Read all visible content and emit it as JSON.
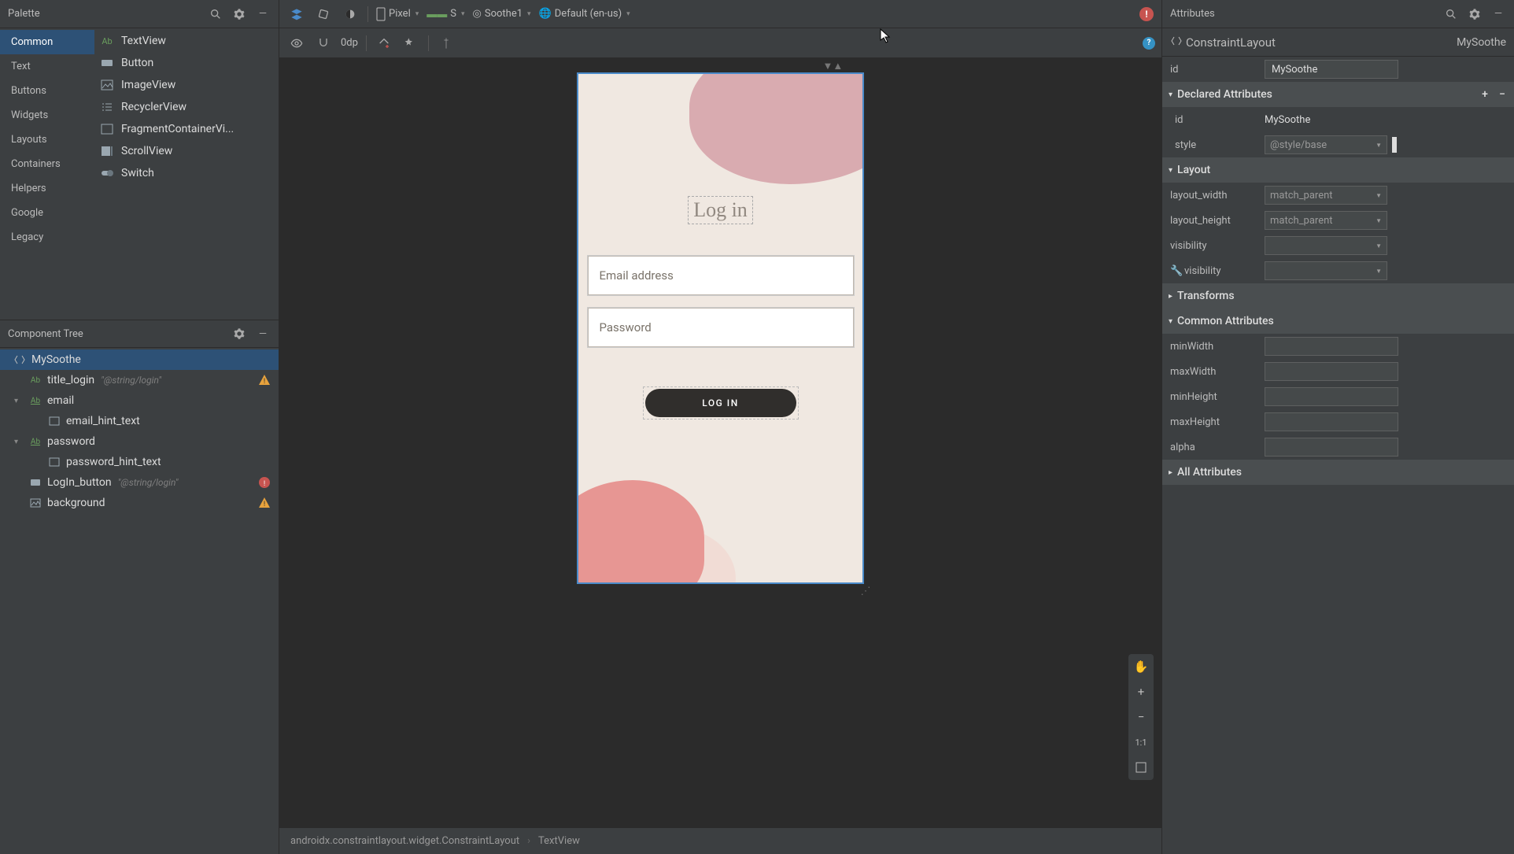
{
  "palette": {
    "title": "Palette",
    "categories": [
      "Common",
      "Text",
      "Buttons",
      "Widgets",
      "Layouts",
      "Containers",
      "Helpers",
      "Google",
      "Legacy"
    ],
    "selected_category": "Common",
    "items": [
      {
        "icon": "Ab",
        "label": "TextView"
      },
      {
        "icon": "rect",
        "label": "Button"
      },
      {
        "icon": "image",
        "label": "ImageView"
      },
      {
        "icon": "list",
        "label": "RecyclerView"
      },
      {
        "icon": "frame",
        "label": "FragmentContainerVi..."
      },
      {
        "icon": "scroll",
        "label": "ScrollView"
      },
      {
        "icon": "switch",
        "label": "Switch"
      }
    ]
  },
  "component_tree": {
    "title": "Component Tree",
    "nodes": [
      {
        "level": 0,
        "icon": "constraint",
        "label": "MySoothe",
        "selected": true
      },
      {
        "level": 1,
        "icon": "Ab",
        "label": "title_login",
        "ann": "\"@string/login\"",
        "warn": "warning"
      },
      {
        "level": 1,
        "icon": "Ab",
        "label": "email",
        "chevron": true
      },
      {
        "level": 2,
        "icon": "frame",
        "label": "email_hint_text"
      },
      {
        "level": 1,
        "icon": "Ab",
        "label": "password",
        "chevron": true
      },
      {
        "level": 2,
        "icon": "frame",
        "label": "password_hint_text"
      },
      {
        "level": 1,
        "icon": "rect",
        "label": "LogIn_button",
        "ann": "\"@string/login\"",
        "warn": "error"
      },
      {
        "level": 1,
        "icon": "image",
        "label": "background",
        "warn": "warning"
      }
    ]
  },
  "toolbar": {
    "device": "Pixel",
    "api": "S",
    "theme": "Soothe1",
    "locale": "Default (en-us)",
    "dp": "0dp"
  },
  "design": {
    "login_title": "Log in",
    "email_hint": "Email address",
    "password_hint": "Password",
    "button_label": "LOG IN"
  },
  "breadcrumb": {
    "item1": "androidx.constraintlayout.widget.ConstraintLayout",
    "item2": "TextView"
  },
  "attributes": {
    "title": "Attributes",
    "component_type": "ConstraintLayout",
    "class_name": "MySoothe",
    "id_label": "id",
    "id_value": "MySoothe",
    "sections": {
      "declared": "Declared Attributes",
      "layout": "Layout",
      "transforms": "Transforms",
      "common": "Common Attributes",
      "all": "All Attributes"
    },
    "declared": {
      "id_label": "id",
      "id_value": "MySoothe",
      "style_label": "style",
      "style_value": "@style/base"
    },
    "layout": {
      "width_label": "layout_width",
      "width_value": "match_parent",
      "height_label": "layout_height",
      "height_value": "match_parent",
      "visibility_label": "visibility",
      "tools_visibility_label": "visibility"
    },
    "common": {
      "minWidth": "minWidth",
      "maxWidth": "maxWidth",
      "minHeight": "minHeight",
      "maxHeight": "maxHeight",
      "alpha": "alpha"
    }
  }
}
